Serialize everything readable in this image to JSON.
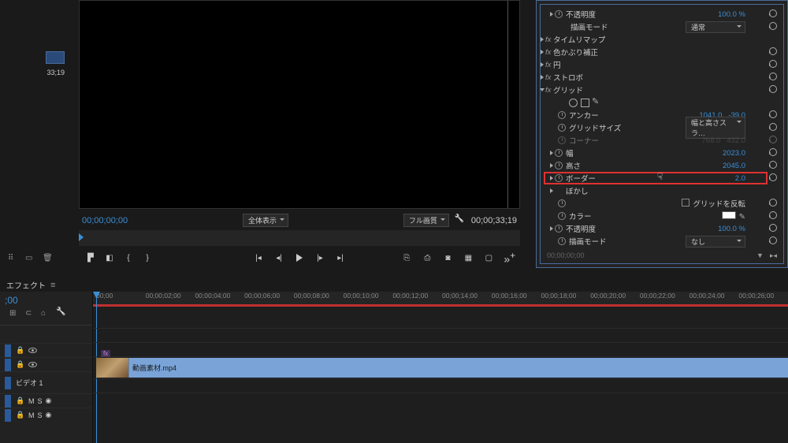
{
  "source": {
    "time": "33;19"
  },
  "program": {
    "tc_left": "00;00;00;00",
    "tc_right": "00;00;33;19",
    "display_left": "全体表示",
    "display_right": "フル画質"
  },
  "fx": {
    "opacity": {
      "label": "不透明度",
      "value": "100.0 %"
    },
    "blend": {
      "label": "描画モード",
      "value": "通常"
    },
    "timeremap": "タイムリマップ",
    "lumetri": "色かぶり補正",
    "circle": "円",
    "strobe": "ストロボ",
    "grid": {
      "label": "グリッド",
      "anchor": {
        "label": "アンカー",
        "x": "1041.0",
        "y": "-39.0"
      },
      "gridsize": {
        "label": "グリッドサイズ",
        "value": "幅と高さスラ…"
      },
      "corner": {
        "label": "コーナー",
        "x": "768.0",
        "y": "432.0"
      },
      "width": {
        "label": "幅",
        "value": "2023.0"
      },
      "height": {
        "label": "高さ",
        "value": "2045.0"
      },
      "border": {
        "label": "ボーダー",
        "value": "2.0"
      },
      "blur": {
        "label": "ぼかし"
      },
      "invert": {
        "label": "グリッドを反転"
      },
      "color": {
        "label": "カラー"
      },
      "opacity": {
        "label": "不透明度",
        "value": "100.0 %"
      },
      "blend": {
        "label": "描画モード",
        "value": "なし"
      }
    },
    "footer_time": "00;00;00;00"
  },
  "fx_tab": "エフェクト",
  "timeline": {
    "playhead": ";00",
    "times": [
      "00;00",
      "00;00;02;00",
      "00;00;04;00",
      "00;00;06;00",
      "00;00;08;00",
      "00;00;10;00",
      "00;00;12;00",
      "00;00;14;00",
      "00;00;16;00",
      "00;00;18;00",
      "00;00;20;00",
      "00;00;22;00",
      "00;00;24;00",
      "00;00;26;00"
    ],
    "v1": "ビデオ 1",
    "clip": "動画素材.mp4",
    "fx_badge": "fx",
    "m": "M",
    "s": "S"
  }
}
